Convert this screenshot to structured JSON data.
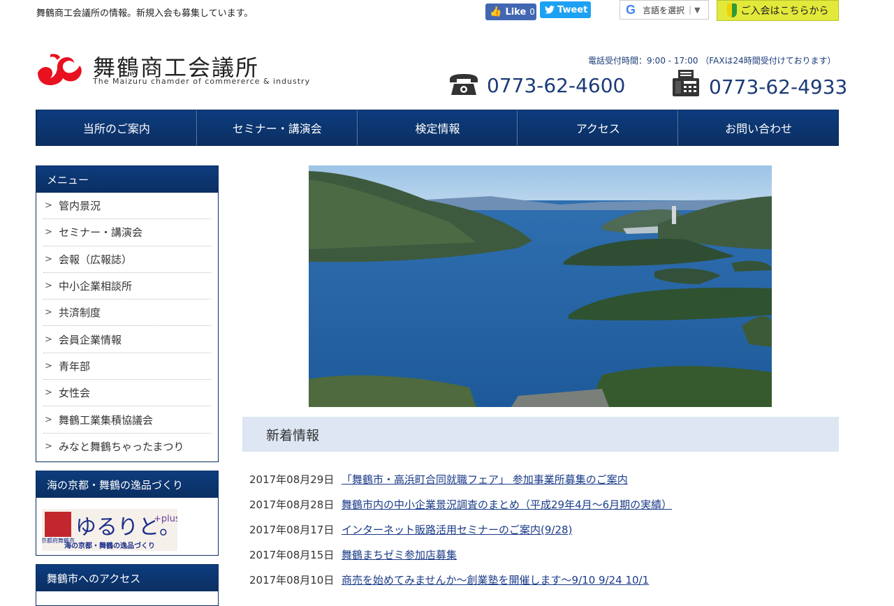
{
  "topbar": {
    "tagline": "舞鶴商工会議所の情報。新規入会も募集しています。",
    "fb_like_label": "Like",
    "fb_like_count": "0",
    "tweet_label": "Tweet",
    "translate_label": "言語を選択",
    "join_label": "ご入会はこちらから"
  },
  "header": {
    "org_name": "舞鶴商工会議所",
    "org_name_en": "The Maizuru chamder of commererce & industry",
    "hours": "電話受付時間：9:00 - 17:00 （FAXは24時間受付けております）",
    "tel": "0773-62-4600",
    "fax": "0773-62-4933"
  },
  "nav": [
    {
      "label": "当所のご案内"
    },
    {
      "label": "セミナー・講演会"
    },
    {
      "label": "検定情報"
    },
    {
      "label": "アクセス"
    },
    {
      "label": "お問い合わせ"
    }
  ],
  "sidebar": {
    "menu_title": "メニュー",
    "menu": [
      {
        "label": "管内景況"
      },
      {
        "label": "セミナー・講演会"
      },
      {
        "label": "会報（広報誌）"
      },
      {
        "label": "中小企業相談所"
      },
      {
        "label": "共済制度"
      },
      {
        "label": "会員企業情報"
      },
      {
        "label": "青年部"
      },
      {
        "label": "女性会"
      },
      {
        "label": "舞鶴工業集積協議会"
      },
      {
        "label": "みなと舞鶴ちゃったまつり"
      }
    ],
    "products_title": "海の京都・舞鶴の逸品づくり",
    "banner": {
      "side_text": "京都府舞鶴市",
      "main_text": "ゆるりと。",
      "plus_text": "+plus",
      "bottom_text": "海の京都・舞鶴の逸品づくり"
    },
    "access_title": "舞鶴市へのアクセス"
  },
  "news": {
    "title": "新着情報",
    "items": [
      {
        "date": "2017年08月29日",
        "title": "「舞鶴市・高浜町合同就職フェア」 参加事業所募集のご案内"
      },
      {
        "date": "2017年08月28日",
        "title": "舞鶴市内の中小企業景況調査のまとめ（平成29年4月～6月期の実績）"
      },
      {
        "date": "2017年08月17日",
        "title": "インターネット販路活用セミナーのご案内(9/28)"
      },
      {
        "date": "2017年08月15日",
        "title": "舞鶴まちゼミ参加店募集"
      },
      {
        "date": "2017年08月10日",
        "title": "商売を始めてみませんか～創業塾を開催します～9/10 9/24 10/1"
      }
    ]
  },
  "colors": {
    "nav_blue": "#0b2f62",
    "text_blue": "#1b3b78",
    "join_yellow": "#e2e93a",
    "news_head_bg": "#dde6f2",
    "logo_red": "#e8111f"
  }
}
